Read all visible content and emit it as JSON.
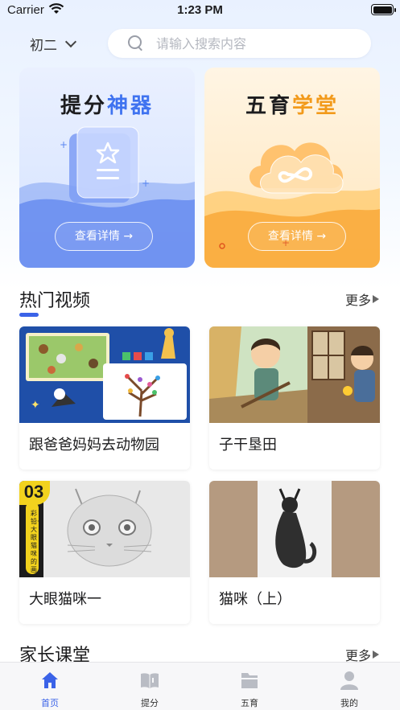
{
  "status_bar": {
    "carrier": "Carrier",
    "time": "1:23 PM"
  },
  "header": {
    "grade": "初二",
    "search_placeholder": "请输入搜索内容"
  },
  "promos": [
    {
      "title_dark": "提分",
      "title_accent": "神器",
      "button": "查看详情 →"
    },
    {
      "title_dark": "五育",
      "title_accent": "学堂",
      "button": "查看详情 →"
    }
  ],
  "hot_videos": {
    "title": "热门视频",
    "more": "更多",
    "items": [
      {
        "title": "跟爸爸妈妈去动物园"
      },
      {
        "title": "子干垦田"
      },
      {
        "title": "大眼猫咪一",
        "badge": "03",
        "side_text": "彩铅·大眼猫咪的画法"
      },
      {
        "title": "猫咪（上）"
      }
    ]
  },
  "parent_class": {
    "title": "家长课堂",
    "more": "更多"
  },
  "tab_bar": [
    {
      "label": "首页",
      "icon": "home-icon",
      "active": true
    },
    {
      "label": "提分",
      "icon": "book-icon",
      "active": false
    },
    {
      "label": "五育",
      "icon": "folder-icon",
      "active": false
    },
    {
      "label": "我的",
      "icon": "user-icon",
      "active": false
    }
  ],
  "colors": {
    "accent_blue": "#3b63e8",
    "accent_orange": "#f29a1b",
    "inactive_icon": "#b9bcc4"
  }
}
